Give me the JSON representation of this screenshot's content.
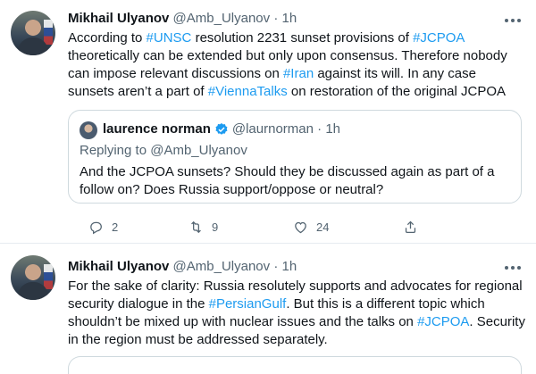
{
  "tweets": [
    {
      "author": {
        "name": "Mikhail Ulyanov",
        "handle": "@Amb_Ulyanov"
      },
      "time": "1h",
      "separator": "·",
      "body": [
        {
          "t": "According to "
        },
        {
          "t": "#UNSC",
          "link": true
        },
        {
          "t": " resolution 2231 sunset provisions of "
        },
        {
          "t": "#JCPOA",
          "link": true
        },
        {
          "t": " theoretically can be extended but only upon consensus. Therefore nobody can impose relevant discussions on "
        },
        {
          "t": "#Iran",
          "link": true
        },
        {
          "t": " against its will. In any case sunsets aren’t a part of "
        },
        {
          "t": "#ViennaTalks",
          "link": true
        },
        {
          "t": " on restoration of the original JCPOA"
        }
      ],
      "quoted": {
        "author": {
          "name": "laurence norman",
          "handle": "@laurnorman"
        },
        "time": "1h",
        "separator": "·",
        "replying_to": "Replying to @Amb_Ulyanov",
        "body": "And the JCPOA  sunsets? Should they be discussed again as part of a follow on? Does Russia support/oppose or neutral?"
      },
      "actions": {
        "replies": "2",
        "retweets": "9",
        "likes": "24"
      }
    },
    {
      "author": {
        "name": "Mikhail Ulyanov",
        "handle": "@Amb_Ulyanov"
      },
      "time": "1h",
      "separator": "·",
      "body": [
        {
          "t": "For the sake of clarity: Russia resolutely supports and advocates for regional security dialogue in the "
        },
        {
          "t": "#PersianGulf",
          "link": true
        },
        {
          "t": ". But this is a different topic which shouldn’t be mixed up with nuclear issues and the talks on "
        },
        {
          "t": "#JCPOA",
          "link": true
        },
        {
          "t": ". Security in the region must be addressed separately."
        }
      ]
    }
  ],
  "colors": {
    "link": "#1d9bf0",
    "text": "#0f1419",
    "muted": "#536471",
    "border": "#cfd9de",
    "verified": "#1d9bf0"
  },
  "icons": [
    "more-icon",
    "verified-icon",
    "reply-icon",
    "retweet-icon",
    "like-icon",
    "share-icon"
  ]
}
